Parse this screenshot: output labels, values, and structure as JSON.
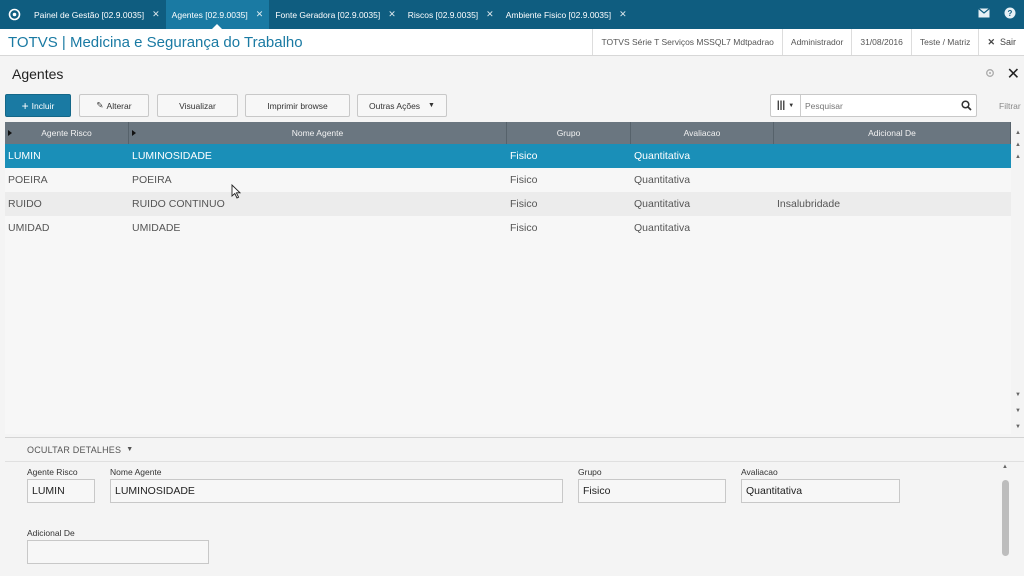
{
  "tabs": [
    {
      "label": "Painel de Gestão [02.9.0035]",
      "active": false
    },
    {
      "label": "Agentes [02.9.0035]",
      "active": true
    },
    {
      "label": "Fonte Geradora [02.9.0035]",
      "active": false
    },
    {
      "label": "Riscos [02.9.0035]",
      "active": false
    },
    {
      "label": "Ambiente Fisico [02.9.0035]",
      "active": false
    }
  ],
  "header": {
    "app_title": "TOTVS | Medicina e Segurança do Trabalho",
    "environment": "TOTVS Série T Serviços MSSQL7 Mdtpadrao",
    "user": "Administrador",
    "date": "31/08/2016",
    "branch": "Teste / Matriz",
    "exit_label": "Sair"
  },
  "page": {
    "title": "Agentes"
  },
  "toolbar": {
    "incluir": "Incluir",
    "alterar": "Alterar",
    "visualizar": "Visualizar",
    "imprimir": "Imprimir browse",
    "outras": "Outras Ações",
    "search_placeholder": "Pesquisar",
    "filtrar": "Filtrar"
  },
  "grid": {
    "columns": [
      "Agente Risco",
      "Nome Agente",
      "Grupo",
      "Avaliacao",
      "Adicional De"
    ],
    "rows": [
      [
        "LUMIN",
        "LUMINOSIDADE",
        "Fisico",
        "Quantitativa",
        ""
      ],
      [
        "POEIRA",
        "POEIRA",
        "Fisico",
        "Quantitativa",
        ""
      ],
      [
        "RUIDO",
        "RUIDO CONTINUO",
        "Fisico",
        "Quantitativa",
        "Insalubridade"
      ],
      [
        "UMIDAD",
        "UMIDADE",
        "Fisico",
        "Quantitativa",
        ""
      ]
    ]
  },
  "details": {
    "toggle_label": "OCULTAR DETALHES",
    "agente_risco_label": "Agente Risco",
    "agente_risco_value": "LUMIN",
    "nome_agente_label": "Nome Agente",
    "nome_agente_value": "LUMINOSIDADE",
    "grupo_label": "Grupo",
    "grupo_value": "Fisico",
    "avaliacao_label": "Avaliacao",
    "avaliacao_value": "Quantitativa",
    "adicional_label": "Adicional De",
    "adicional_value": ""
  },
  "colors": {
    "brand": "#0f5d80",
    "accent": "#1a7aa3",
    "selected_row": "#1a8fb8",
    "grid_header": "#6a7680"
  }
}
